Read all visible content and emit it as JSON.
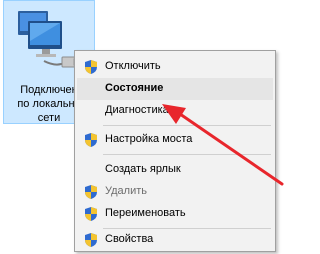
{
  "desktop_icon": {
    "label_lines": [
      "Подключен",
      "по локально",
      "сети"
    ]
  },
  "context_menu": {
    "items": [
      {
        "label": "Отключить",
        "icon": "shield-icon"
      },
      {
        "label": "Состояние",
        "icon": ""
      },
      {
        "label": "Диагностика",
        "icon": ""
      },
      {
        "label": "Настройка моста",
        "icon": "shield-icon"
      },
      {
        "label": "Создать ярлык",
        "icon": ""
      },
      {
        "label": "Удалить",
        "icon": "shield-icon"
      },
      {
        "label": "Переименовать",
        "icon": "shield-icon"
      },
      {
        "label": "Свойства",
        "icon": "shield-icon"
      }
    ],
    "default_item": "Состояние",
    "highlighted_item": "Состояние",
    "disabled_item": "Удалить"
  },
  "colors": {
    "icon_selection": "#cde8ff",
    "menu_background": "#f2f2f2",
    "highlight": "#e5e5e5",
    "arrow": "#e8262c"
  }
}
